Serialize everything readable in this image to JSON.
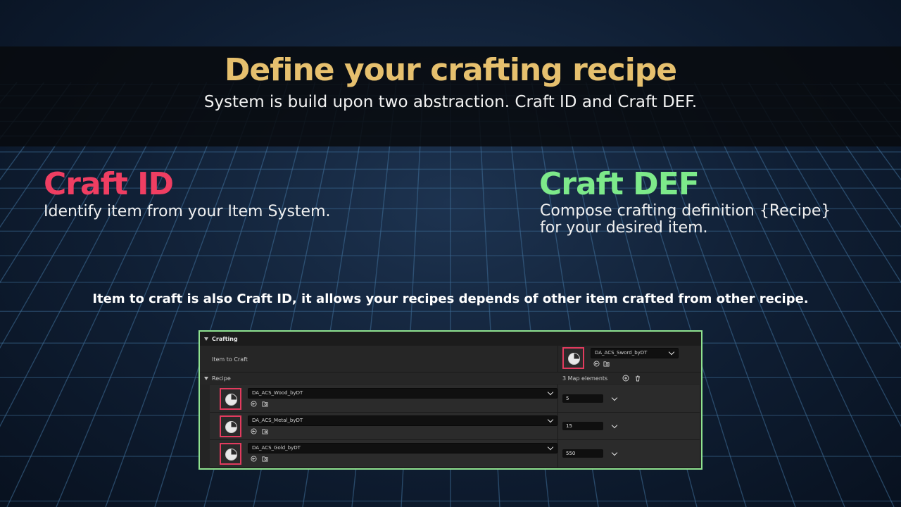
{
  "slide": {
    "title": "Define your crafting recipe",
    "subtitle": "System is build upon two abstraction. Craft ID and Craft DEF.",
    "craft_id": {
      "heading": "Craft ID",
      "description": "Identify item from your Item System."
    },
    "craft_def": {
      "heading": "Craft DEF",
      "description": "Compose crafting definition {Recipe}\n for your desired item."
    },
    "note": "Item to craft is also Craft ID, it allows your recipes depends of other item crafted from other recipe."
  },
  "colors": {
    "title": "#e6c06e",
    "craft_id": "#ef3e62",
    "craft_def": "#7de98a",
    "panel_border": "#8fe28f",
    "thumb_border": "#e23b5e"
  },
  "editor": {
    "section_label": "Crafting",
    "item_to_craft_label": "Item to Craft",
    "item_to_craft_value": "DA_ACS_Sword_byDT",
    "recipe_label": "Recipe",
    "map_count": "3 Map elements",
    "recipe_entries": [
      {
        "asset": "DA_ACS_Wood_byDT",
        "quantity": "5"
      },
      {
        "asset": "DA_ACS_Metal_byDT",
        "quantity": "15"
      },
      {
        "asset": "DA_ACS_Gold_byDT",
        "quantity": "550"
      }
    ],
    "icons": [
      "chevron-down-icon",
      "browse-arrow-icon",
      "folder-search-icon",
      "add-element-icon",
      "delete-icon",
      "asset-thumbnail-icon"
    ]
  }
}
